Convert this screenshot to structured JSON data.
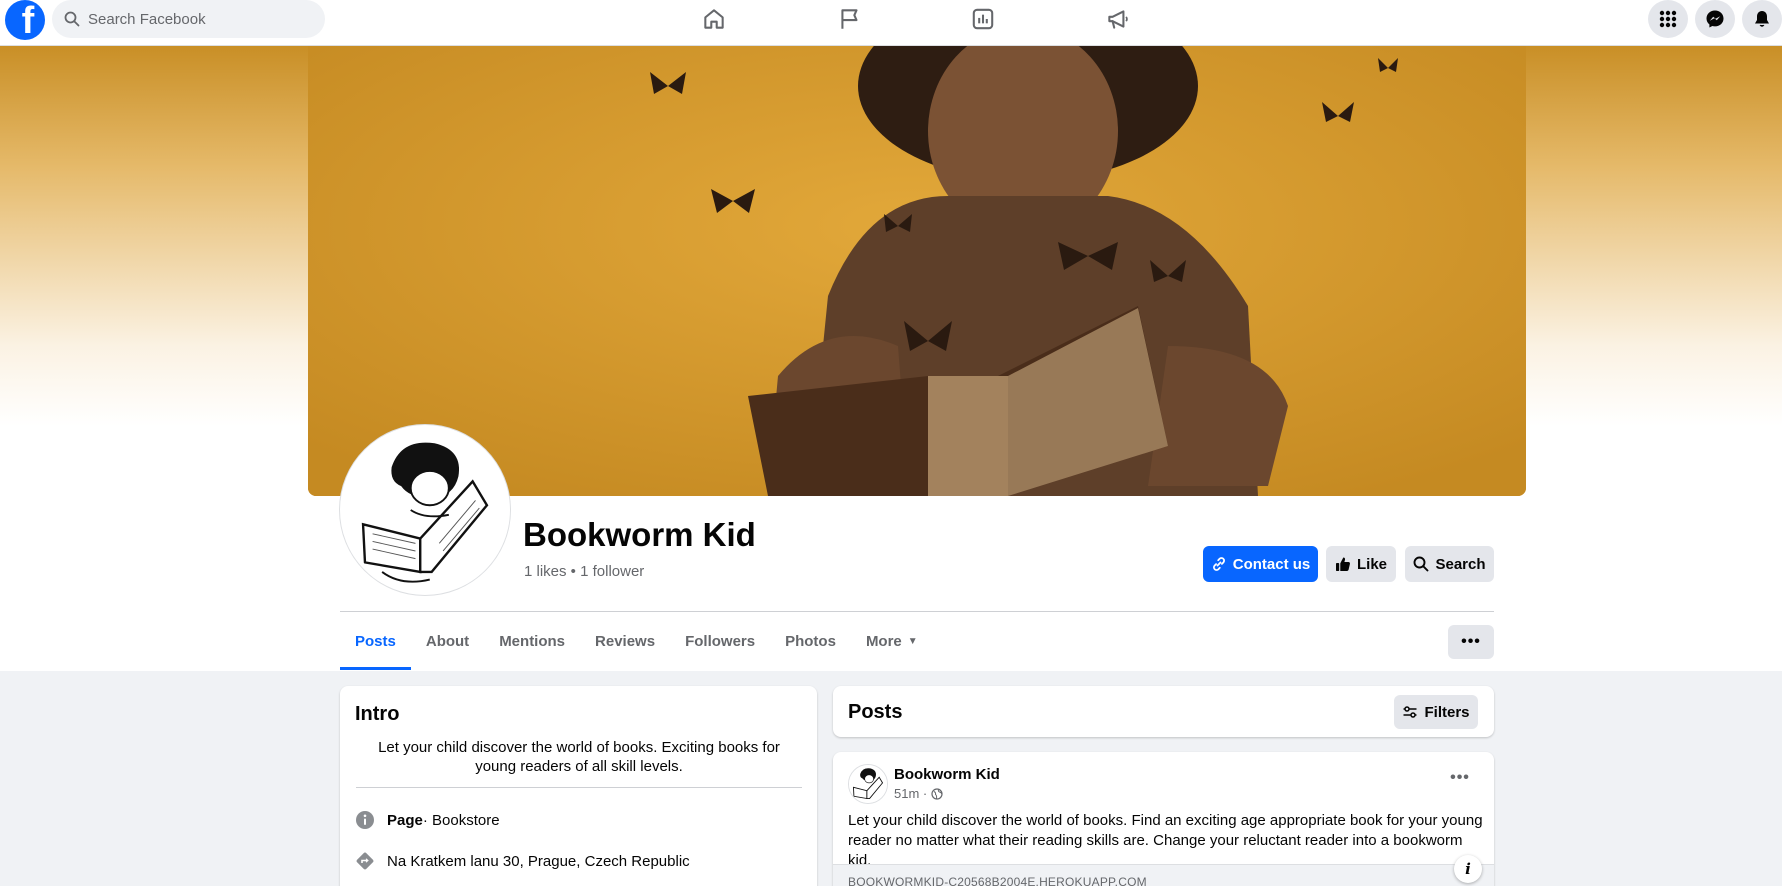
{
  "topbar": {
    "logo_letter": "f",
    "search_placeholder": "Search Facebook",
    "nav_icons": [
      "home-icon",
      "flag-icon",
      "insights-icon",
      "megaphone-icon"
    ],
    "right_icons": [
      "menu-grid-icon",
      "messenger-icon",
      "bell-icon"
    ],
    "accent_color": "#0866ff"
  },
  "page": {
    "name": "Bookworm Kid",
    "stats": "1 likes • 1 follower",
    "actions": {
      "contact_label": "Contact us",
      "like_label": "Like",
      "search_label": "Search"
    },
    "tabs": [
      {
        "label": "Posts",
        "active": true
      },
      {
        "label": "About"
      },
      {
        "label": "Mentions"
      },
      {
        "label": "Reviews"
      },
      {
        "label": "Followers"
      },
      {
        "label": "Photos"
      },
      {
        "label": "More"
      }
    ],
    "more_menu": "•••"
  },
  "intro": {
    "title": "Intro",
    "bio": "Let your child discover the world of books. Exciting books for young readers of all skill levels.",
    "category_label": "Page",
    "category_value": " · Bookstore",
    "address": "Na Kratkem lanu 30, Prague, Czech Republic"
  },
  "posts": {
    "title": "Posts",
    "filters_label": "Filters",
    "items": [
      {
        "author": "Bookworm Kid",
        "time": "51m ·",
        "menu": "•••",
        "text": "Let your child discover the world of books. Find an exciting age appropriate book for your young reader no matter what their reading skills are. Change your reluctant reader into a bookworm kid.",
        "link_domain": "BOOKWORMKID-C20568B2004E.HEROKUAPP.COM",
        "info_label": "i"
      }
    ]
  }
}
